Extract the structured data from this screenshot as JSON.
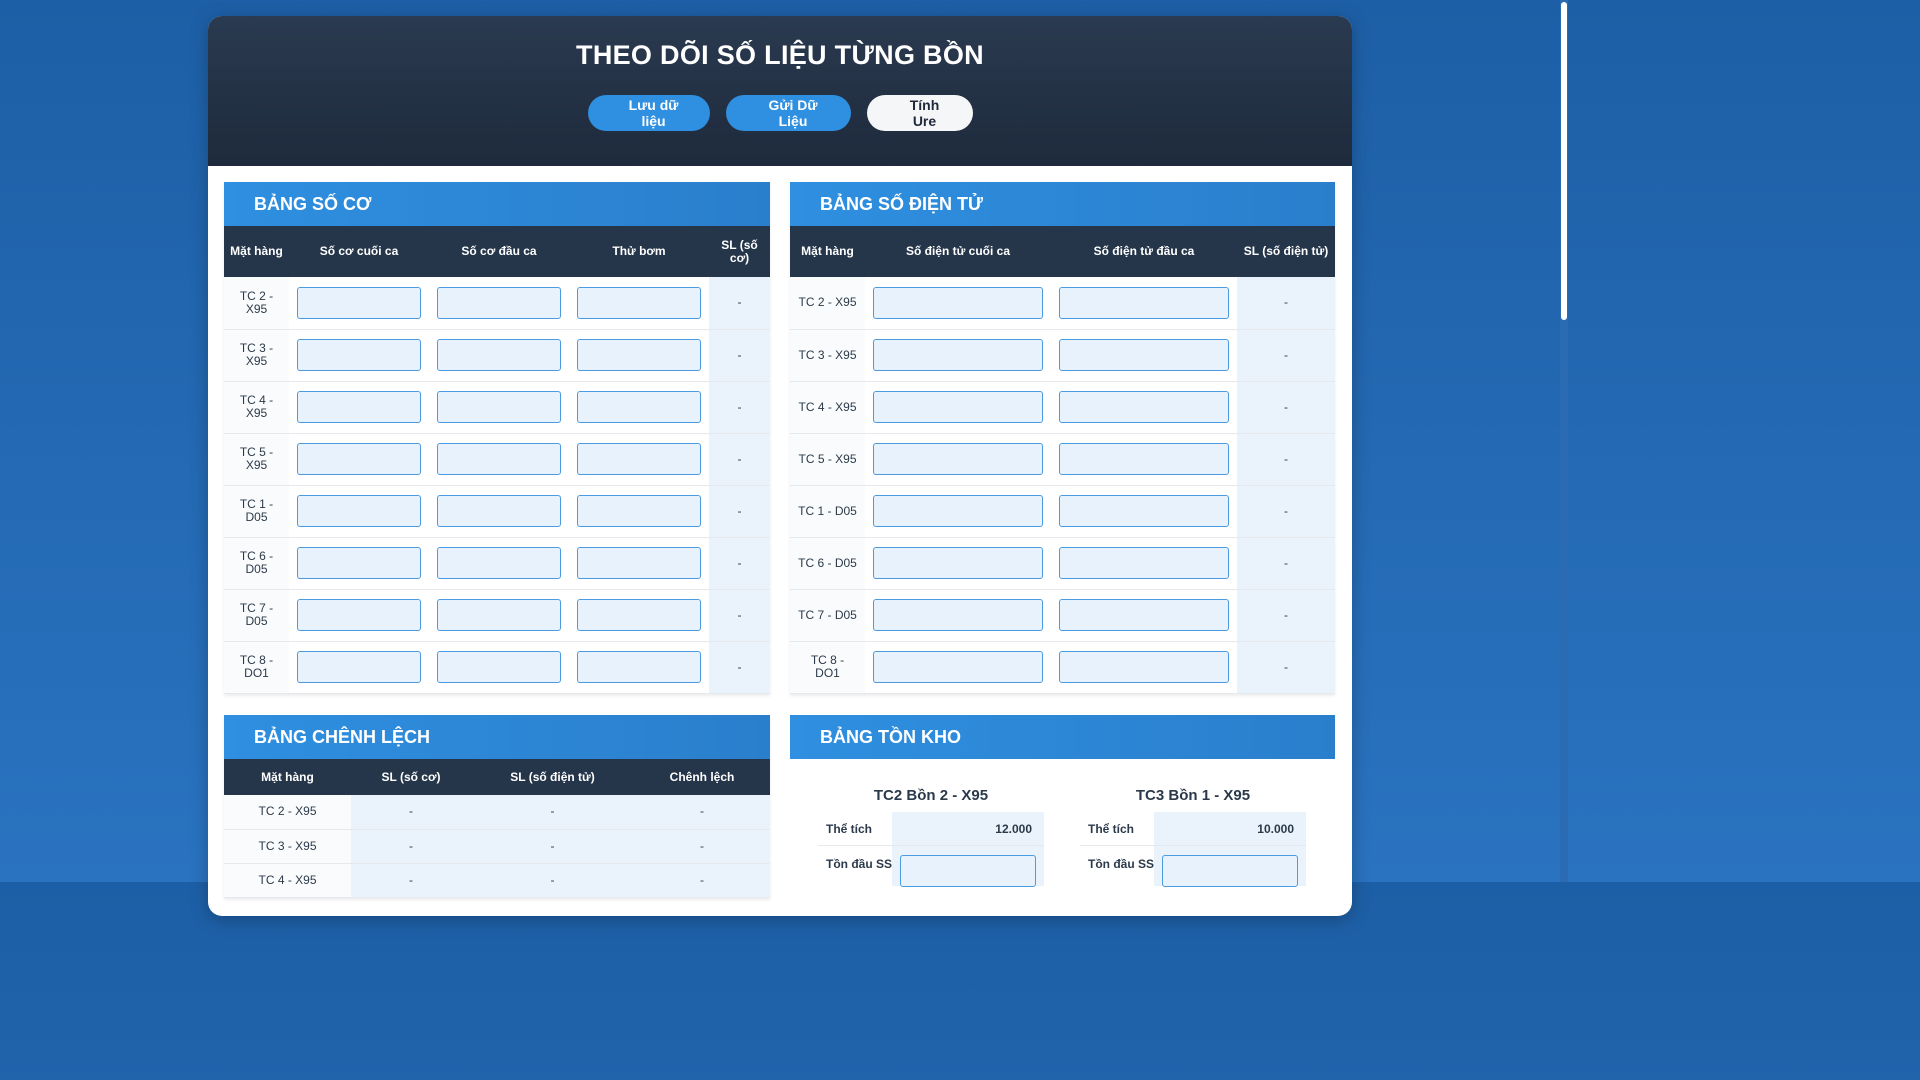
{
  "header": {
    "title": "THEO DÕI SỐ LIỆU TỪNG BỒN",
    "buttons": {
      "save": "Lưu dữ liệu",
      "send": "Gửi Dữ Liệu",
      "urea": "Tính Ure"
    }
  },
  "so_co": {
    "title": "BẢNG SỐ CƠ",
    "columns": [
      "Mặt hàng",
      "Số cơ cuối ca",
      "Số cơ đầu ca",
      "Thử bơm",
      "SL (số cơ)"
    ],
    "rows": [
      {
        "item": "TC 2 - X95",
        "sl": "-"
      },
      {
        "item": "TC 3 - X95",
        "sl": "-"
      },
      {
        "item": "TC 4 - X95",
        "sl": "-"
      },
      {
        "item": "TC 5 - X95",
        "sl": "-"
      },
      {
        "item": "TC 1 - D05",
        "sl": "-"
      },
      {
        "item": "TC 6 - D05",
        "sl": "-"
      },
      {
        "item": "TC 7 - D05",
        "sl": "-"
      },
      {
        "item": "TC 8 - DO1",
        "sl": "-"
      }
    ]
  },
  "so_dien_tu": {
    "title": "BẢNG SỐ ĐIỆN TỬ",
    "columns": [
      "Mặt hàng",
      "Số điện tử cuối ca",
      "Số điện tử đầu ca",
      "SL (số điện tử)"
    ],
    "rows": [
      {
        "item": "TC 2 - X95",
        "sl": "-"
      },
      {
        "item": "TC 3 - X95",
        "sl": "-"
      },
      {
        "item": "TC 4 - X95",
        "sl": "-"
      },
      {
        "item": "TC 5 - X95",
        "sl": "-"
      },
      {
        "item": "TC 1 - D05",
        "sl": "-"
      },
      {
        "item": "TC 6 - D05",
        "sl": "-"
      },
      {
        "item": "TC 7 - D05",
        "sl": "-"
      },
      {
        "item": "TC 8 - DO1",
        "sl": "-"
      }
    ]
  },
  "chenh_lech": {
    "title": "BẢNG CHÊNH LỆCH",
    "columns": [
      "Mặt hàng",
      "SL (số cơ)",
      "SL (số điện tử)",
      "Chênh lệch"
    ],
    "rows": [
      {
        "item": "TC 2 - X95",
        "sl_co": "-",
        "sl_dt": "-",
        "diff": "-"
      },
      {
        "item": "TC 3 - X95",
        "sl_co": "-",
        "sl_dt": "-",
        "diff": "-"
      },
      {
        "item": "TC 4 - X95",
        "sl_co": "-",
        "sl_dt": "-",
        "diff": "-"
      }
    ]
  },
  "ton_kho": {
    "title": "BẢNG TỒN KHO",
    "tanks": [
      {
        "name": "TC2 Bồn 2 - X95",
        "volume_label": "Thể tích",
        "volume": "12.000",
        "start_label": "Tồn đầu SS"
      },
      {
        "name": "TC3 Bồn 1 - X95",
        "volume_label": "Thể tích",
        "volume": "10.000",
        "start_label": "Tồn đầu SS"
      }
    ]
  }
}
